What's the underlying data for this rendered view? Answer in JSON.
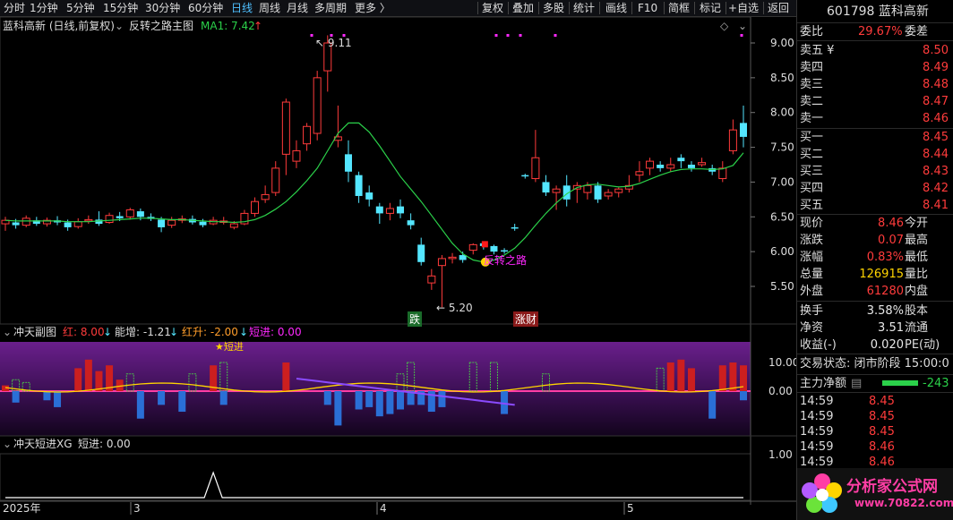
{
  "toolbar": {
    "periods": [
      "分时",
      "1分钟",
      "5分钟",
      "15分钟",
      "30分钟",
      "60分钟",
      "日线",
      "周线",
      "月线",
      "多周期",
      "更多 〉"
    ],
    "active_period": "日线",
    "actions": [
      "复权",
      "叠加",
      "多股",
      "统计",
      "画线",
      "F10",
      "简框",
      "标记",
      "+自选",
      "返回"
    ]
  },
  "main_header": {
    "stock_label": "蓝科高新 (日线,前复权)",
    "indicator_name": "反转之路主图",
    "ma_label": "MA1: 7.42"
  },
  "sub1_header": {
    "name": "冲天副图",
    "red_label": "红: 8.00",
    "energy_label": "能增: -1.21",
    "redup_label": "红升: -2.00",
    "short_label": "短进: 0.00"
  },
  "sub2_header": {
    "name": "冲天短进XG",
    "short_label": "短进: 0.00"
  },
  "annotations": {
    "high_label": "9.11",
    "low_label": "5.20",
    "signal_label": "反转之路",
    "marker_die": "跌",
    "marker_zhangcai": "涨财",
    "marker_duanjin": "短进"
  },
  "chart_data": [
    {
      "type": "candlestick",
      "title": "反转之路主图",
      "y_ticks": [
        "9.00",
        "8.50",
        "8.00",
        "7.50",
        "7.00",
        "6.50",
        "6.00",
        "5.50"
      ],
      "ylim": [
        5.2,
        9.2
      ],
      "x_ticks": [
        "2025年",
        "3",
        "4",
        "5"
      ],
      "series": [
        {
          "name": "MA1",
          "color": "#2bd14a",
          "last_value": 7.42
        }
      ],
      "candles": [
        [
          6.4,
          6.45,
          6.5,
          6.3
        ],
        [
          6.42,
          6.38,
          6.47,
          6.33
        ],
        [
          6.38,
          6.48,
          6.52,
          6.35
        ],
        [
          6.45,
          6.4,
          6.5,
          6.37
        ],
        [
          6.4,
          6.45,
          6.49,
          6.36
        ],
        [
          6.45,
          6.42,
          6.51,
          6.38
        ],
        [
          6.42,
          6.35,
          6.46,
          6.3
        ],
        [
          6.36,
          6.43,
          6.48,
          6.33
        ],
        [
          6.44,
          6.46,
          6.52,
          6.4
        ],
        [
          6.46,
          6.4,
          6.58,
          6.37
        ],
        [
          6.42,
          6.52,
          6.56,
          6.4
        ],
        [
          6.51,
          6.48,
          6.57,
          6.44
        ],
        [
          6.5,
          6.6,
          6.63,
          6.46
        ],
        [
          6.58,
          6.5,
          6.62,
          6.45
        ],
        [
          6.5,
          6.47,
          6.55,
          6.44
        ],
        [
          6.46,
          6.35,
          6.5,
          6.28
        ],
        [
          6.38,
          6.45,
          6.5,
          6.34
        ],
        [
          6.45,
          6.47,
          6.52,
          6.41
        ],
        [
          6.47,
          6.42,
          6.52,
          6.39
        ],
        [
          6.43,
          6.38,
          6.47,
          6.35
        ],
        [
          6.4,
          6.45,
          6.5,
          6.38
        ],
        [
          6.43,
          6.44,
          6.5,
          6.39
        ],
        [
          6.35,
          6.4,
          6.44,
          6.32
        ],
        [
          6.4,
          6.55,
          6.6,
          6.38
        ],
        [
          6.55,
          6.72,
          6.78,
          6.5
        ],
        [
          6.75,
          6.82,
          6.95,
          6.7
        ],
        [
          6.85,
          7.2,
          7.3,
          6.8
        ],
        [
          7.4,
          8.15,
          8.2,
          7.1
        ],
        [
          7.3,
          7.45,
          7.6,
          7.2
        ],
        [
          7.55,
          7.8,
          7.85,
          7.45
        ],
        [
          7.7,
          8.5,
          8.6,
          7.6
        ],
        [
          8.6,
          9.0,
          9.11,
          8.3
        ],
        [
          7.6,
          7.65,
          8.1,
          7.5
        ],
        [
          7.4,
          7.15,
          7.6,
          7.0
        ],
        [
          7.1,
          6.8,
          7.15,
          6.7
        ],
        [
          6.85,
          6.75,
          6.95,
          6.65
        ],
        [
          6.65,
          6.55,
          6.7,
          6.4
        ],
        [
          6.55,
          6.62,
          6.7,
          6.45
        ],
        [
          6.65,
          6.55,
          6.75,
          6.48
        ],
        [
          6.45,
          6.38,
          6.55,
          6.32
        ],
        [
          6.1,
          5.85,
          6.2,
          5.8
        ],
        [
          5.55,
          5.65,
          5.75,
          5.45
        ],
        [
          5.8,
          5.9,
          5.95,
          5.2
        ],
        [
          5.9,
          5.92,
          5.98,
          5.83
        ],
        [
          5.95,
          5.88,
          6.0,
          5.84
        ],
        [
          6.02,
          6.1,
          6.12,
          5.96
        ],
        [
          6.12,
          6.08,
          6.14,
          6.03
        ],
        [
          6.08,
          6.0,
          6.1,
          5.96
        ],
        [
          6.02,
          6.01,
          6.05,
          5.97
        ],
        [
          6.35,
          6.34,
          6.4,
          6.3
        ],
        [
          7.1,
          7.09,
          7.12,
          7.05
        ],
        [
          7.05,
          7.35,
          7.75,
          7.0
        ],
        [
          7.0,
          6.85,
          7.1,
          6.8
        ],
        [
          6.85,
          6.9,
          6.95,
          6.6
        ],
        [
          6.95,
          6.75,
          7.1,
          6.65
        ],
        [
          6.9,
          6.95,
          7.0,
          6.7
        ],
        [
          6.85,
          6.95,
          7.0,
          6.75
        ],
        [
          6.95,
          6.75,
          7.0,
          6.7
        ],
        [
          6.8,
          6.85,
          6.9,
          6.75
        ],
        [
          6.85,
          6.9,
          6.92,
          6.78
        ],
        [
          6.9,
          6.95,
          7.1,
          6.85
        ],
        [
          7.1,
          7.15,
          7.3,
          7.0
        ],
        [
          7.2,
          7.3,
          7.35,
          7.1
        ],
        [
          7.25,
          7.2,
          7.3,
          7.15
        ],
        [
          7.2,
          7.25,
          7.35,
          7.15
        ],
        [
          7.35,
          7.3,
          7.4,
          7.2
        ],
        [
          7.25,
          7.2,
          7.3,
          7.15
        ],
        [
          7.25,
          7.28,
          7.35,
          7.22
        ],
        [
          7.2,
          7.15,
          7.25,
          7.1
        ],
        [
          7.05,
          7.2,
          7.3,
          7.0
        ],
        [
          7.45,
          7.75,
          7.9,
          7.4
        ],
        [
          7.85,
          7.65,
          8.1,
          7.5
        ]
      ],
      "ma1": [
        6.45,
        6.44,
        6.44,
        6.44,
        6.44,
        6.44,
        6.43,
        6.43,
        6.43,
        6.44,
        6.45,
        6.46,
        6.47,
        6.48,
        6.48,
        6.47,
        6.46,
        6.46,
        6.45,
        6.44,
        6.43,
        6.43,
        6.42,
        6.43,
        6.46,
        6.52,
        6.61,
        6.72,
        6.86,
        7.02,
        7.2,
        7.45,
        7.7,
        7.85,
        7.85,
        7.72,
        7.52,
        7.3,
        7.08,
        6.9,
        6.72,
        6.52,
        6.32,
        6.12,
        5.97,
        5.88,
        5.85,
        5.88,
        5.95,
        6.05,
        6.2,
        6.38,
        6.55,
        6.7,
        6.83,
        6.92,
        6.96,
        6.97,
        6.95,
        6.93,
        6.94,
        6.98,
        7.04,
        7.1,
        7.15,
        7.18,
        7.19,
        7.19,
        7.18,
        7.19,
        7.24,
        7.42
      ]
    },
    {
      "type": "bar",
      "title": "冲天副图",
      "y_ticks": [
        "10.00",
        "0.00"
      ],
      "ylim": [
        -15,
        15
      ]
    },
    {
      "type": "line",
      "title": "冲天短进XG",
      "y_ticks": [
        "1.00"
      ],
      "ylim": [
        0,
        1.2
      ]
    }
  ],
  "right_panel": {
    "code_name": "601798 蓝科高新",
    "weibi": {
      "label": "委比",
      "value": "29.67%",
      "label2": "委差"
    },
    "asks": [
      {
        "label": "卖五 ¥",
        "price": "8.50"
      },
      {
        "label": "卖四",
        "price": "8.49"
      },
      {
        "label": "卖三",
        "price": "8.48"
      },
      {
        "label": "卖二",
        "price": "8.47"
      },
      {
        "label": "卖一",
        "price": "8.46"
      }
    ],
    "bids": [
      {
        "label": "买一",
        "price": "8.45"
      },
      {
        "label": "买二",
        "price": "8.44"
      },
      {
        "label": "买三",
        "price": "8.43"
      },
      {
        "label": "买四",
        "price": "8.42"
      },
      {
        "label": "买五",
        "price": "8.41"
      }
    ],
    "quote": [
      {
        "label": "现价",
        "value": "8.46",
        "label2": "今开"
      },
      {
        "label": "涨跌",
        "value": "0.07",
        "label2": "最高"
      },
      {
        "label": "涨幅",
        "value": "0.83%",
        "label2": "最低"
      },
      {
        "label": "总量",
        "value": "126915",
        "label2": "量比"
      },
      {
        "label": "外盘",
        "value": "61280",
        "label2": "内盘"
      }
    ],
    "stats": [
      {
        "label": "换手",
        "value": "3.58%",
        "label2": "股本"
      },
      {
        "label": "净资",
        "value": "3.51",
        "label2": "流通"
      },
      {
        "label": "收益(-)",
        "value": "0.020",
        "label2": "PE(动)"
      }
    ],
    "status": "交易状态: 闭市阶段 15:00:0",
    "main_flow_label": "主力净额",
    "main_flow_value": "-243",
    "ticks": [
      {
        "time": "14:59",
        "price": "8.45"
      },
      {
        "time": "14:59",
        "price": "8.45"
      },
      {
        "time": "14:59",
        "price": "8.45"
      },
      {
        "time": "14:59",
        "price": "8.46"
      },
      {
        "time": "14:59",
        "price": "8.46"
      }
    ]
  },
  "watermark": {
    "site_name": "分析家公式网",
    "url": "www.70822.com"
  },
  "colors": {
    "up": "#ff3b3b",
    "down": "#54e6ff",
    "ma": "#2bd14a",
    "signal": "#ff28ff",
    "sub_purple": "#5a1a78"
  }
}
